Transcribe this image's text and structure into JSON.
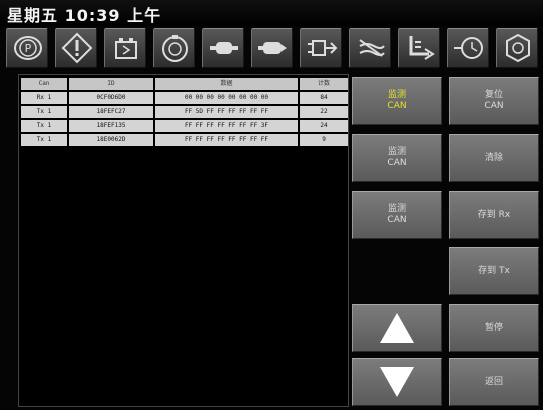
{
  "status": {
    "clock": "星期五 10:39 上午"
  },
  "toolbar": {
    "icons": [
      "parking-brake-icon",
      "warning-icon",
      "battery-icon",
      "speed-icon",
      "motor-icon",
      "motor-right-icon",
      "gearbox-icon",
      "fan-icon",
      "exhaust-icon",
      "sensor-icon",
      "engine-icon"
    ]
  },
  "table": {
    "headers": [
      "Can",
      "ID",
      "数据",
      "计数"
    ],
    "rows": [
      {
        "ch": "Rx 1",
        "id": "0CF0D6D0",
        "data": "00 00 00 00 00 00 00 00",
        "count": "84"
      },
      {
        "ch": "Tx 1",
        "id": "18FEFC27",
        "data": "FF 5D FF FF FF FF FF FF",
        "count": "22"
      },
      {
        "ch": "Tx 1",
        "id": "18FEF135",
        "data": "FF FF FF FF FF FF FF 3F",
        "count": "24"
      },
      {
        "ch": "Tx 1",
        "id": "18E0062D",
        "data": "FF FF FF FF FF FF FF FF",
        "count": "9"
      }
    ]
  },
  "buttons": {
    "can1": [
      "监测",
      "CAN"
    ],
    "reset": [
      "复位",
      "CAN"
    ],
    "can2": [
      "监测",
      "CAN"
    ],
    "clear": "清除",
    "can3": [
      "监测",
      "CAN"
    ],
    "save_rx": "存到 Rx",
    "save_tx": "存到 Tx",
    "pause": "暂停",
    "exit": "返回"
  },
  "colors": {
    "active": "#e8e030",
    "button": "#6e6e6e",
    "background": "#050505"
  }
}
